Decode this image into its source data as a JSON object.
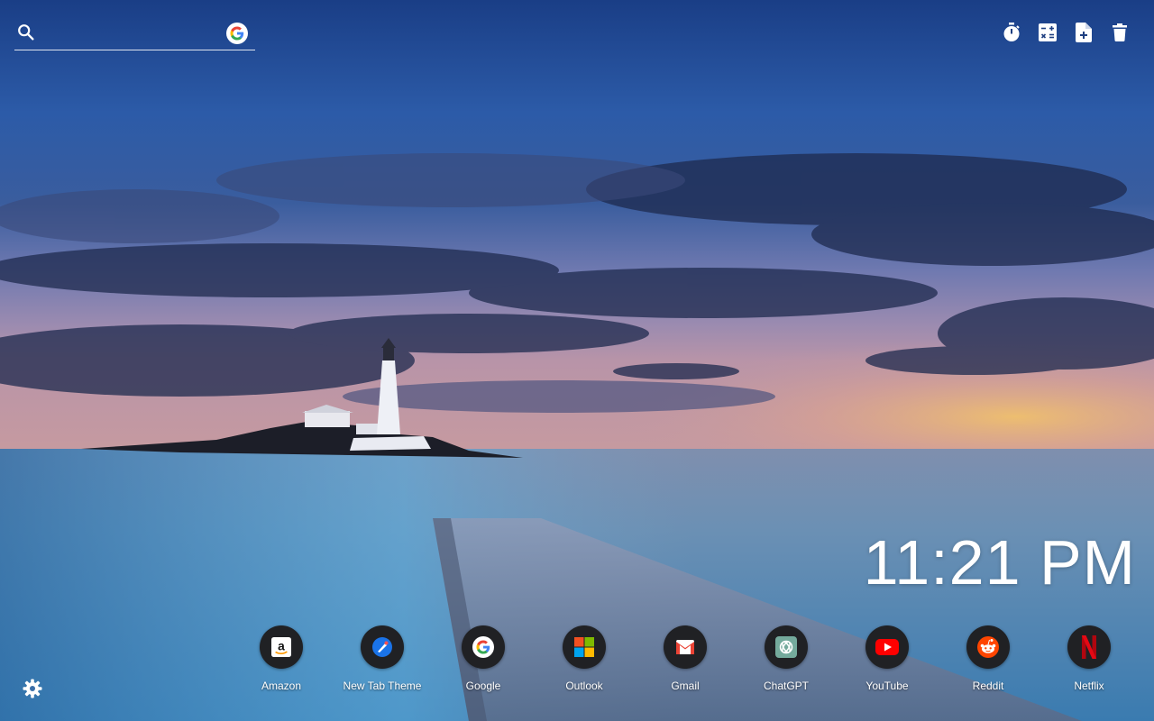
{
  "search": {
    "placeholder": "",
    "value": "",
    "icon": "search-icon",
    "engine_icon": "google-icon"
  },
  "toolbar": {
    "buttons": [
      {
        "icon": "timer-icon"
      },
      {
        "icon": "calculator-icon"
      },
      {
        "icon": "add-note-icon"
      },
      {
        "icon": "trash-icon"
      }
    ]
  },
  "clock": {
    "time": "11:21 PM"
  },
  "shortcuts": [
    {
      "label": "Amazon",
      "icon": "amazon-icon"
    },
    {
      "label": "New Tab Theme",
      "icon": "new-tab-theme-icon"
    },
    {
      "label": "Google",
      "icon": "google-icon"
    },
    {
      "label": "Outlook",
      "icon": "microsoft-icon"
    },
    {
      "label": "Gmail",
      "icon": "gmail-icon"
    },
    {
      "label": "ChatGPT",
      "icon": "chatgpt-icon"
    },
    {
      "label": "YouTube",
      "icon": "youtube-icon"
    },
    {
      "label": "Reddit",
      "icon": "reddit-icon"
    },
    {
      "label": "Netflix",
      "icon": "netflix-icon"
    }
  ],
  "settings": {
    "icon": "gear-icon"
  },
  "colors": {
    "google_blue": "#4285F4",
    "google_red": "#EA4335",
    "google_yellow": "#FBBC05",
    "google_green": "#34A853",
    "youtube_red": "#FF0000",
    "reddit_orange": "#FF4500",
    "netflix_red": "#E50914",
    "chatgpt_teal": "#74AA9C"
  }
}
